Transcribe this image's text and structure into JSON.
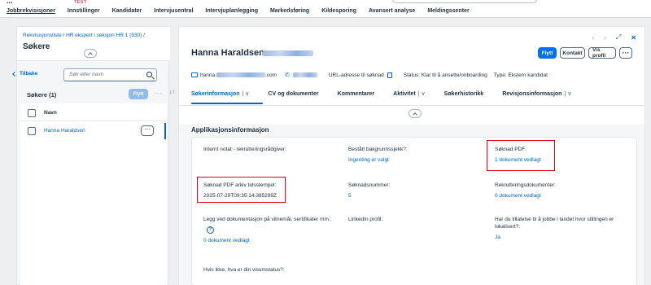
{
  "topnav": {
    "brand": "...",
    "brand_tag": "TEST",
    "items": [
      "Jobbrekvisisjoner",
      "Innstillinger",
      "Kandidater",
      "Intervjusentral",
      "Intervjuplanlegging",
      "Markedsføring",
      "Kildesporing",
      "Avansert analyse",
      "Meldingssenter"
    ]
  },
  "left": {
    "breadcrumb": "Rekvisisjonsliste / HR ekspert i seksjon HR 1 (930) /",
    "title": "Søkere",
    "back_label": "Tilbake",
    "search_placeholder": "Søk etter navn",
    "list_title": "Søkere (1)",
    "move_label": "Flytt",
    "column_name": "Navn",
    "rows": [
      "Hanna Haraldsen"
    ]
  },
  "right": {
    "name": "Hanna Haraldsen",
    "buttons": {
      "move": "Flytt",
      "contact": "Kontakt",
      "profile": "Vis profil"
    },
    "email_prefix": "hanna.",
    "email_suffix": ".com",
    "url_label": "URL-adresse til søknad",
    "status": "Status: Klar til å ansette/onboarding",
    "type": "Type: Ekstern kandidat",
    "tabs": [
      {
        "label": "Søkerinformasjon",
        "dropdown": true
      },
      {
        "label": "CV og dokumenter",
        "dropdown": false
      },
      {
        "label": "Kommentarer",
        "dropdown": false
      },
      {
        "label": "Aktivitet",
        "dropdown": true
      },
      {
        "label": "Søkerhistorikk",
        "dropdown": false
      },
      {
        "label": "Revisjonsinformasjon",
        "dropdown": true
      }
    ],
    "section_title": "Applikasjonsinformasjon",
    "fields": {
      "internal_note": {
        "label": "Internt notat - rekrutteringsrådgiver:"
      },
      "background_check": {
        "label": "Bestått bakgrunnssjekk?:",
        "value": "Ingenting er valgt"
      },
      "application_pdf": {
        "label": "Søknad PDF:",
        "value": "1 dokument vedlagt"
      },
      "pdf_archive": {
        "label": "Søknad PDF arkiv tidsstempel:",
        "value": "2025-07-29T09:35:14.385299Z"
      },
      "application_number": {
        "label": "Søknadsnummer:",
        "value": "5"
      },
      "recruitment_docs": {
        "label": "Rekrutteringsdokumenter:",
        "value": "0 dokument vedlagt"
      },
      "diploma_docs": {
        "label": "Legg ved dokumentasjon på vitnemål, sertifikater mm.:",
        "value": "0 dokument vedlagt"
      },
      "linkedin": {
        "label": "LinkedIn profil:"
      },
      "work_permit": {
        "label": "Har du tillatelse til å jobbe i landet hvor stillingen er lokalisert?:",
        "value": "Ja"
      },
      "visa_status": {
        "label": "Hvis ikke, hva er din visumstatus?:"
      }
    }
  }
}
